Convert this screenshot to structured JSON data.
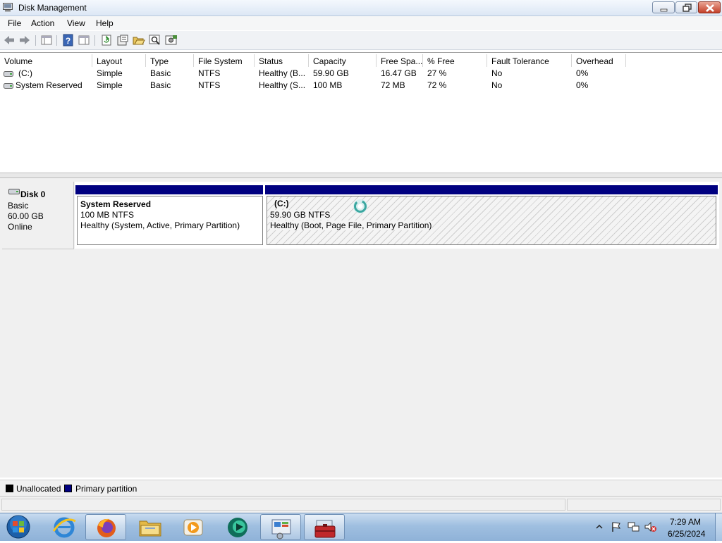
{
  "window": {
    "title": "Disk Management",
    "title_icon": "disk-management-icon",
    "buttons": [
      "minimize-icon",
      "maximize-icon",
      "close-icon"
    ]
  },
  "menu": [
    "File",
    "Action",
    "View",
    "Help"
  ],
  "toolbar": {
    "icons": [
      "back-arrow-icon",
      "forward-arrow-icon",
      "console-tree-icon",
      "help-icon",
      "properties-pane-icon",
      "refresh-icon",
      "properties-icon",
      "open-folder-icon",
      "search-icon",
      "disk-settings-icon"
    ]
  },
  "volume_table": {
    "columns": [
      "Volume",
      "Layout",
      "Type",
      "File System",
      "Status",
      "Capacity",
      "Free Spa...",
      "% Free",
      "Fault Tolerance",
      "Overhead"
    ],
    "rows": [
      [
        "(C:)",
        "Simple",
        "Basic",
        "NTFS",
        "Healthy (B...",
        "59.90 GB",
        "16.47 GB",
        "27 %",
        "No",
        "0%"
      ],
      [
        "System Reserved",
        "Simple",
        "Basic",
        "NTFS",
        "Healthy (S...",
        "100 MB",
        "72 MB",
        "72 %",
        "No",
        "0%"
      ]
    ]
  },
  "disk": {
    "name": "Disk 0",
    "type": "Basic",
    "size": "60.00 GB",
    "state": "Online",
    "partitions": [
      {
        "name": "System Reserved",
        "size": "100 MB NTFS",
        "status": "Healthy (System, Active, Primary Partition)"
      },
      {
        "name": "(C:)",
        "size": "59.90 GB NTFS",
        "status": "Healthy (Boot, Page File, Primary Partition)"
      }
    ]
  },
  "legend": [
    {
      "label": "Unallocated",
      "color": "#000000"
    },
    {
      "label": "Primary partition",
      "color": "#000080"
    }
  ],
  "taskbar": {
    "apps": [
      "start-orb-icon",
      "internet-explorer-icon",
      "firefox-icon",
      "file-explorer-icon",
      "media-player-icon",
      "cyberlink-icon",
      "control-panel-icon",
      "computer-management-icon"
    ],
    "time": "7:29 AM",
    "date": "6/25/2024"
  },
  "colors": {
    "primary_partition": "#000080",
    "taskbar": "#9fbfe0",
    "loading": "#3aa7a0"
  }
}
